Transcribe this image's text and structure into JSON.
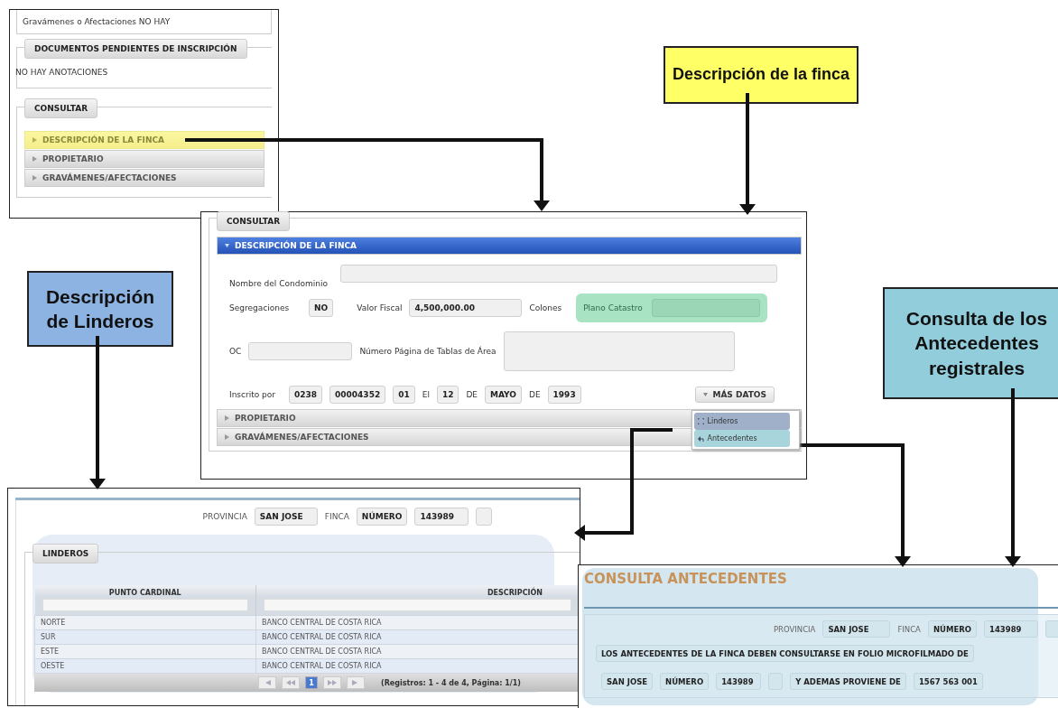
{
  "callouts": [
    {
      "text": "Descripción de la finca",
      "color": "#ffff66"
    },
    {
      "text": "Descripción de Linderos",
      "color": "#8db3e2"
    },
    {
      "text": "Consulta de los Antecedentes registrales",
      "color": "#92cddc"
    }
  ],
  "summary_panel": {
    "gravamenes_text": "Gravámenes o Afectaciones NO HAY",
    "documents_legend": "DOCUMENTOS PENDIENTES DE INSCRIPCIÓN",
    "documents_text": "NO HAY ANOTACIONES",
    "consult_legend": "CONSULTAR",
    "sections": [
      {
        "label": "DESCRIPCIÓN DE LA FINCA",
        "highlighted": true
      },
      {
        "label": "PROPIETARIO",
        "highlighted": false
      },
      {
        "label": "GRAVÁMENES/AFECTACIONES",
        "highlighted": false
      }
    ]
  },
  "detail_panel": {
    "legend": "CONSULTAR",
    "sections": [
      {
        "label": "DESCRIPCIÓN DE LA FINCA",
        "expanded": true
      },
      {
        "label": "PROPIETARIO",
        "expanded": false
      },
      {
        "label": "GRAVÁMENES/AFECTACIONES",
        "expanded": false
      }
    ],
    "condominio_label": "Nombre del Condominio",
    "segregaciones_label": "Segregaciones",
    "segregaciones": "NO",
    "valor_fiscal_label": "Valor Fiscal",
    "valor_fiscal": "4,500,000.00",
    "valor_unit": "Colones",
    "plano_label": "Plano Catastro",
    "oc_label": "OC",
    "tablas_label": "Número Página de Tablas de Área",
    "inscrito_label": "Inscrito por",
    "inscrito_parts": [
      {
        "kind": "field",
        "text": "0238"
      },
      {
        "kind": "field",
        "text": "00004352"
      },
      {
        "kind": "field",
        "text": "01"
      },
      {
        "kind": "label",
        "text": "El"
      },
      {
        "kind": "field",
        "text": "12"
      },
      {
        "kind": "label",
        "text": "DE"
      },
      {
        "kind": "field",
        "text": "MAYO"
      },
      {
        "kind": "label",
        "text": "DE"
      },
      {
        "kind": "field",
        "text": "1993"
      }
    ],
    "more_button": "MÁS DATOS",
    "menu": [
      {
        "label": "Linderos",
        "color": "#9fb0c8"
      },
      {
        "label": "Antecedentes",
        "color": "#a8d4dc"
      }
    ]
  },
  "linderos_panel": {
    "provincia_label": "PROVINCIA",
    "provincia": "SAN JOSE",
    "finca_label": "FINCA",
    "finca_type": "NÚMERO",
    "finca_number": "143989",
    "legend": "LINDEROS",
    "columns": [
      "PUNTO CARDINAL",
      "DESCRIPCIÓN"
    ],
    "rows": [
      [
        "NORTE",
        "BANCO CENTRAL DE COSTA RICA"
      ],
      [
        "SUR",
        "BANCO CENTRAL DE COSTA RICA"
      ],
      [
        "ESTE",
        "BANCO CENTRAL DE COSTA RICA"
      ],
      [
        "OESTE",
        "BANCO CENTRAL DE COSTA RICA"
      ]
    ],
    "pages": [
      {
        "label": "1",
        "selected": true
      }
    ],
    "pager_summary": "(Registros: 1 - 4 de 4, Página: 1/1)"
  },
  "antecedentes_panel": {
    "title": "CONSULTA ANTECEDENTES",
    "provincia_label": "PROVINCIA",
    "provincia": "SAN JOSE",
    "finca_label": "FINCA",
    "finca_type": "NÚMERO",
    "finca_number": "143989",
    "notice": "LOS ANTECEDENTES DE LA FINCA DEBEN CONSULTARSE EN FOLIO MICROFILMADO DE",
    "fields": [
      {
        "kind": "field",
        "text": "SAN JOSE"
      },
      {
        "kind": "field",
        "text": "NÚMERO"
      },
      {
        "kind": "field",
        "text": "143989"
      },
      {
        "kind": "blank"
      },
      {
        "kind": "field",
        "text": "Y ADEMAS PROVIENE DE"
      },
      {
        "kind": "field",
        "text": "1567 563 001"
      }
    ]
  }
}
